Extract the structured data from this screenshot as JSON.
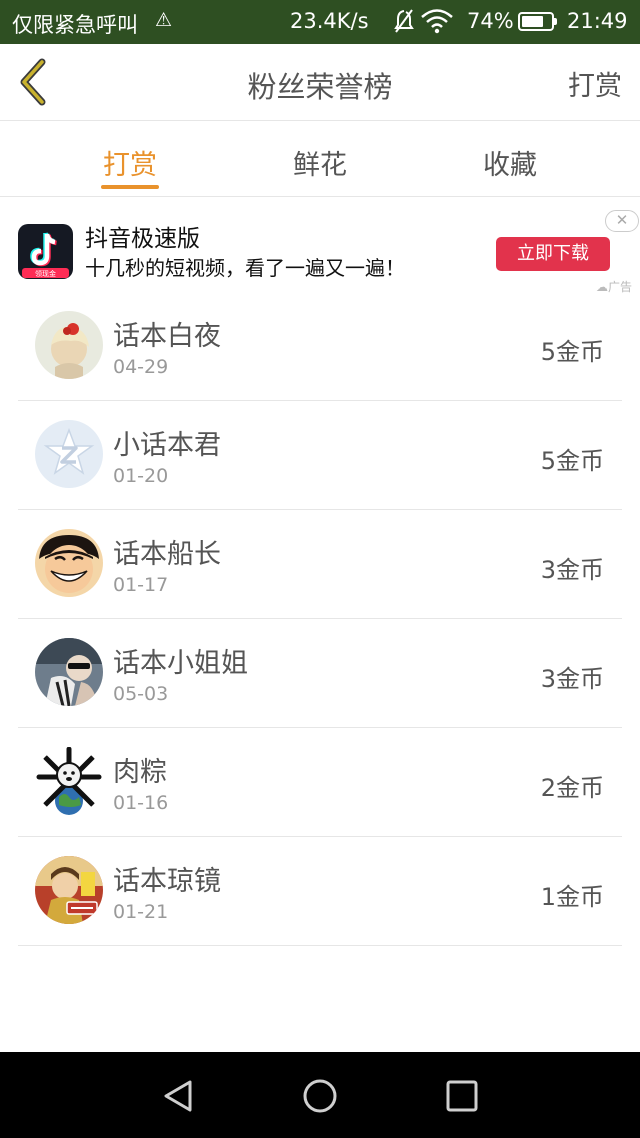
{
  "status_bar": {
    "left_text": "仅限紧急呼叫",
    "net_speed": "23.4K/s",
    "battery_pct": "74%",
    "battery_level": 0.74,
    "time": "21:49"
  },
  "header": {
    "title": "粉丝荣誉榜",
    "action_label": "打赏"
  },
  "tabs": [
    {
      "label": "打赏",
      "active": true
    },
    {
      "label": "鲜花",
      "active": false
    },
    {
      "label": "收藏",
      "active": false
    }
  ],
  "ad": {
    "app_name": "抖音极速版",
    "description": "十几秒的短视频，看了一遍又一遍！",
    "cta": "立即下载",
    "label": "广告",
    "icon_badge": "领现金"
  },
  "fans": [
    {
      "name": "话本白夜",
      "date": "04-29",
      "coins": "5金币"
    },
    {
      "name": "小话本君",
      "date": "01-20",
      "coins": "5金币"
    },
    {
      "name": "话本船长",
      "date": "01-17",
      "coins": "3金币"
    },
    {
      "name": "话本小姐姐",
      "date": "05-03",
      "coins": "3金币"
    },
    {
      "name": "肉粽",
      "date": "01-16",
      "coins": "2金币"
    },
    {
      "name": "话本琼镜",
      "date": "01-21",
      "coins": "1金币"
    }
  ],
  "colors": {
    "accent": "#e9922c",
    "status_bar": "#2e4f22",
    "cta": "#e2334c",
    "back_icon": "#c9b22e"
  }
}
